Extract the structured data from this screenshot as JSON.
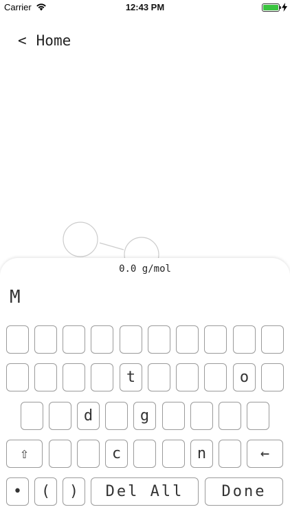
{
  "status_bar": {
    "carrier": "Carrier",
    "time": "12:43 PM",
    "battery_color": "#3ac43f"
  },
  "nav": {
    "back_chevron": "<",
    "back_label": "Home"
  },
  "calculator": {
    "mass_readout": "0.0 g/mol",
    "formula": "M"
  },
  "keyboard": {
    "row1": [
      "",
      "",
      "",
      "",
      "",
      "",
      "",
      "",
      "",
      ""
    ],
    "row2": [
      "",
      "",
      "",
      "",
      "t",
      "",
      "",
      "",
      "o",
      ""
    ],
    "row3": [
      "",
      "",
      "d",
      "",
      "g",
      "",
      "",
      "",
      ""
    ],
    "row4": {
      "shift": "⇧",
      "letters": [
        "",
        "",
        "c",
        "",
        "",
        "n",
        ""
      ],
      "backspace": "←"
    },
    "row5": {
      "bullet": "•",
      "open_paren": "(",
      "close_paren": ")",
      "delete_all": "Del All",
      "done": "Done"
    }
  },
  "icons": {
    "wifi": "wifi-icon",
    "battery": "battery-icon",
    "charging": "charging-bolt-icon"
  }
}
